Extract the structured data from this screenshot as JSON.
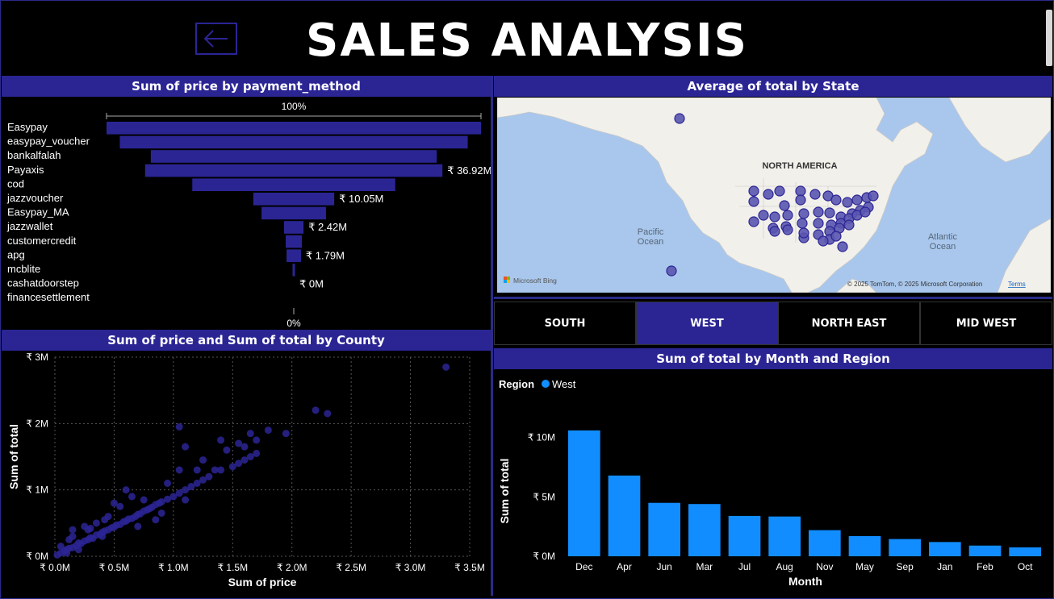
{
  "header": {
    "title": "SALES ANALYSIS"
  },
  "colors": {
    "accent": "#2b2594",
    "bar_west": "#118dff",
    "bubble": "#4a45a8"
  },
  "funnel": {
    "title": "Sum of price by payment_method",
    "top_label": "100%",
    "bottom_label": "0%",
    "chart_data": {
      "type": "funnel",
      "categories": [
        "Easypay",
        "easypay_voucher",
        "bankalfalah",
        "Payaxis",
        "cod",
        "jazzvoucher",
        "Easypay_MA",
        "jazzwallet",
        "customercredit",
        "apg",
        "mcblite",
        "cashatdoorstep",
        "financesettlement"
      ],
      "values": [
        46.5,
        43.2,
        35.5,
        36.92,
        25.2,
        10.05,
        8.0,
        2.42,
        2.0,
        1.79,
        0.3,
        0,
        0
      ],
      "data_labels": [
        "",
        "",
        "",
        "₹ 36.92M",
        "",
        "₹ 10.05M",
        "",
        "₹ 2.42M",
        "",
        "₹ 1.79M",
        "",
        "₹ 0M",
        ""
      ]
    }
  },
  "map": {
    "title": "Average of total by State",
    "continent_label": "NORTH AMERICA",
    "ocean_pacific": "Pacific\nOcean",
    "ocean_atlantic": "Atlantic\nOcean",
    "bing_label": "Microsoft Bing",
    "copyright": "© 2025 TomTom, © 2025 Microsoft Corporation",
    "terms": "Terms"
  },
  "slicer": {
    "items": [
      {
        "label": "SOUTH",
        "active": false
      },
      {
        "label": "WEST",
        "active": true
      },
      {
        "label": "NORTH EAST",
        "active": false
      },
      {
        "label": "MID WEST",
        "active": false
      }
    ]
  },
  "scatter": {
    "title": "Sum of price and Sum of total by County",
    "chart_data": {
      "type": "scatter",
      "xlabel": "Sum of price",
      "ylabel": "Sum of total",
      "xlim": [
        0,
        3.5
      ],
      "ylim": [
        0,
        3
      ],
      "x_ticks": [
        "₹ 0.0M",
        "₹ 0.5M",
        "₹ 1.0M",
        "₹ 1.5M",
        "₹ 2.0M",
        "₹ 2.5M",
        "₹ 3.0M",
        "₹ 3.5M"
      ],
      "y_ticks": [
        "₹ 0M",
        "₹ 1M",
        "₹ 2M",
        "₹ 3M"
      ],
      "points": [
        [
          0.02,
          0.02
        ],
        [
          0.05,
          0.05
        ],
        [
          0.08,
          0.08
        ],
        [
          0.1,
          0.1
        ],
        [
          0.12,
          0.12
        ],
        [
          0.15,
          0.13
        ],
        [
          0.18,
          0.16
        ],
        [
          0.2,
          0.2
        ],
        [
          0.22,
          0.19
        ],
        [
          0.25,
          0.23
        ],
        [
          0.28,
          0.25
        ],
        [
          0.3,
          0.28
        ],
        [
          0.32,
          0.27
        ],
        [
          0.35,
          0.32
        ],
        [
          0.38,
          0.33
        ],
        [
          0.4,
          0.36
        ],
        [
          0.42,
          0.38
        ],
        [
          0.45,
          0.4
        ],
        [
          0.48,
          0.43
        ],
        [
          0.5,
          0.44
        ],
        [
          0.52,
          0.47
        ],
        [
          0.55,
          0.48
        ],
        [
          0.58,
          0.52
        ],
        [
          0.6,
          0.53
        ],
        [
          0.62,
          0.56
        ],
        [
          0.65,
          0.57
        ],
        [
          0.68,
          0.6
        ],
        [
          0.7,
          0.63
        ],
        [
          0.72,
          0.64
        ],
        [
          0.75,
          0.68
        ],
        [
          0.78,
          0.7
        ],
        [
          0.8,
          0.72
        ],
        [
          0.82,
          0.74
        ],
        [
          0.85,
          0.78
        ],
        [
          0.88,
          0.8
        ],
        [
          0.9,
          0.82
        ],
        [
          0.95,
          0.86
        ],
        [
          1.0,
          0.9
        ],
        [
          1.05,
          0.95
        ],
        [
          1.1,
          1.0
        ],
        [
          1.15,
          1.05
        ],
        [
          1.2,
          1.1
        ],
        [
          1.25,
          1.15
        ],
        [
          1.3,
          1.2
        ],
        [
          1.4,
          1.3
        ],
        [
          1.5,
          1.35
        ],
        [
          1.55,
          1.4
        ],
        [
          1.6,
          1.45
        ],
        [
          1.65,
          1.5
        ],
        [
          1.7,
          1.55
        ],
        [
          0.15,
          0.3
        ],
        [
          0.12,
          0.25
        ],
        [
          0.3,
          0.42
        ],
        [
          0.45,
          0.6
        ],
        [
          0.55,
          0.75
        ],
        [
          0.65,
          0.9
        ],
        [
          0.6,
          1.0
        ],
        [
          0.5,
          0.8
        ],
        [
          0.35,
          0.5
        ],
        [
          0.25,
          0.45
        ],
        [
          0.7,
          0.45
        ],
        [
          0.9,
          0.65
        ],
        [
          1.1,
          0.85
        ],
        [
          0.85,
          0.55
        ],
        [
          0.4,
          0.3
        ],
        [
          0.2,
          0.1
        ],
        [
          0.1,
          0.05
        ],
        [
          0.05,
          0.15
        ],
        [
          0.28,
          0.4
        ],
        [
          0.42,
          0.55
        ],
        [
          1.1,
          1.65
        ],
        [
          1.05,
          1.3
        ],
        [
          1.2,
          1.3
        ],
        [
          1.4,
          1.75
        ],
        [
          1.45,
          1.6
        ],
        [
          1.55,
          1.7
        ],
        [
          1.6,
          1.65
        ],
        [
          1.65,
          1.85
        ],
        [
          1.7,
          1.75
        ],
        [
          1.8,
          1.9
        ],
        [
          1.95,
          1.85
        ],
        [
          1.05,
          1.95
        ],
        [
          1.35,
          1.3
        ],
        [
          1.25,
          1.45
        ],
        [
          0.95,
          1.1
        ],
        [
          0.75,
          0.85
        ],
        [
          2.2,
          2.2
        ],
        [
          2.3,
          2.15
        ],
        [
          3.3,
          2.85
        ],
        [
          0.15,
          0.4
        ]
      ]
    }
  },
  "bar": {
    "title": "Sum of total by Month and Region",
    "legend_title": "Region",
    "legend_item": "West",
    "chart_data": {
      "type": "bar",
      "categories": [
        "Dec",
        "Apr",
        "Jun",
        "Mar",
        "Jul",
        "Aug",
        "Nov",
        "May",
        "Sep",
        "Jan",
        "Feb",
        "Oct"
      ],
      "series": [
        {
          "name": "West",
          "values": [
            10.6,
            6.8,
            4.5,
            4.4,
            3.4,
            3.35,
            2.2,
            1.7,
            1.45,
            1.2,
            0.9,
            0.75
          ]
        }
      ],
      "xlabel": "Month",
      "ylabel": "Sum of total",
      "ylim": [
        0,
        11
      ],
      "y_ticks": [
        "₹ 0M",
        "₹ 5M",
        "₹ 10M"
      ]
    }
  }
}
